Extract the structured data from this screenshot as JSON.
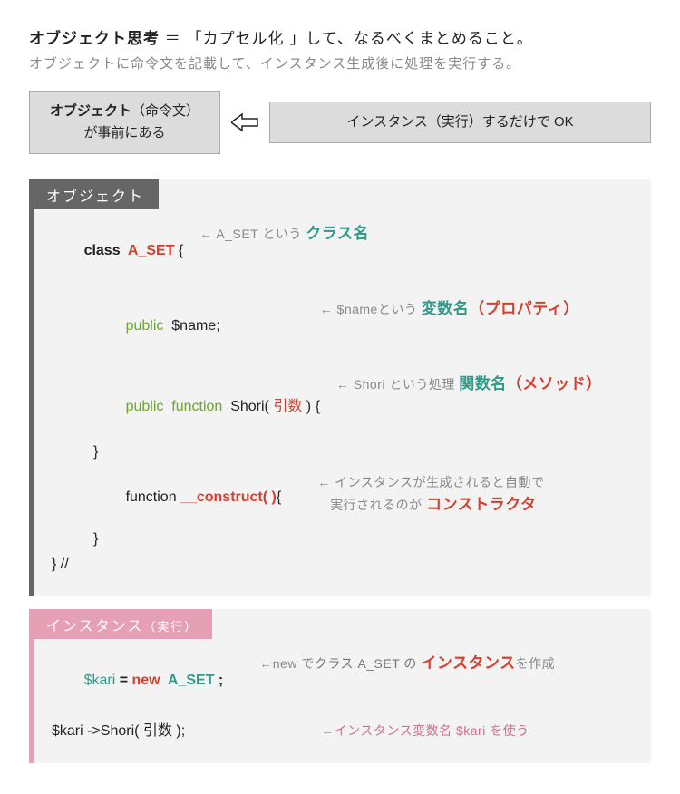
{
  "heading": {
    "term": "オブジェクト思考",
    "eq": " ＝ ",
    "rest": "「カプセル化 」して、なるべくまとめること。"
  },
  "subtitle": "オブジェクトに命令文を記載して、インスタンス生成後に処理を実行する。",
  "left_box": {
    "l1a": "オブジェクト",
    "l1b": "（命令文）",
    "l2": "が事前にある"
  },
  "right_box": "インスタンス（実行）するだけで OK",
  "obj_panel": {
    "title": "オブジェクト",
    "line1": {
      "kw": "class  ",
      "name": "A_SET",
      "rest": " {",
      "c_pre": "← A_SET という ",
      "c_key": "クラス名"
    },
    "line2": {
      "mod": "public  ",
      "var": "$name;",
      "c_pre": "← $nameという ",
      "c_key": "変数名",
      "c_par": "（プロパティ）"
    },
    "line3": {
      "mod": "public  ",
      "fn": "function  ",
      "name": "Shori( ",
      "arg": "引数",
      "close": " ) {",
      "c_pre": "← Shori という処理 ",
      "c_key": "関数名",
      "c_par": "（メソッド）"
    },
    "line4": "}",
    "line5": {
      "fn": "function ",
      "name": "__construct( )",
      "close": "{",
      "c1": "← インスタンスが生成されると自動で",
      "c2": "実行されるのが ",
      "c_key": "コンストラクタ"
    },
    "line6": "}",
    "line7": "} //"
  },
  "inst_panel": {
    "title_a": "インスタンス",
    "title_b": "（実行）",
    "line1": {
      "var": "$kari",
      "eq": " = ",
      "new": "new  ",
      "cls": "A_SET ",
      "semi": ";",
      "c_pre": "←new で",
      "c_mid": "クラス A_SET の ",
      "c_key": "インスタンス",
      "c_post": "を作成"
    },
    "line2": {
      "code": "$kari ->Shori( 引数 );",
      "c_pre": "←",
      "c_pink": "インスタンス変数名 $kari を使う"
    }
  }
}
